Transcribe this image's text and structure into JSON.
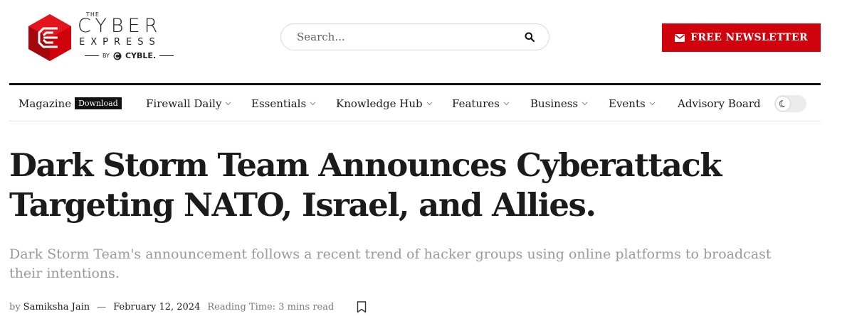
{
  "brand": {
    "the": "THE",
    "name": "CYBER",
    "name2": "EXPRESS",
    "by": "BY",
    "parent": "CYBLE.",
    "logo_icon": "hexagon-stack-logo",
    "colors": {
      "logo_red": "#d0020b",
      "logo_dark": "#8e0b0b"
    }
  },
  "search": {
    "placeholder": "Search...",
    "icon": "search-icon"
  },
  "newsletter": {
    "label": "FREE NEWSLETTER",
    "icon": "envelope-icon",
    "color": "#d0020b"
  },
  "nav": {
    "items": [
      {
        "label": "Magazine",
        "badge": "Download",
        "has_dropdown": false
      },
      {
        "label": "Firewall Daily",
        "has_dropdown": true
      },
      {
        "label": "Essentials",
        "has_dropdown": true
      },
      {
        "label": "Knowledge Hub",
        "has_dropdown": true
      },
      {
        "label": "Features",
        "has_dropdown": true
      },
      {
        "label": "Business",
        "has_dropdown": true
      },
      {
        "label": "Events",
        "has_dropdown": true
      },
      {
        "label": "Advisory Board",
        "has_dropdown": false
      }
    ],
    "theme_toggle_icon": "moon-icon"
  },
  "article": {
    "title_line1": "Dark Storm Team Announces Cyberattack",
    "title_line2": "Targeting NATO, Israel, and Allies.",
    "subtitle_line1": "Dark Storm Team's announcement follows a recent trend of hacker groups using online platforms to broadcast",
    "subtitle_line2": "their intentions.",
    "by": "by",
    "author": "Samiksha Jain",
    "separator": "—",
    "date": "February 12, 2024",
    "reading_time": "Reading Time: 3 mins read",
    "bookmark_icon": "bookmark-icon"
  }
}
